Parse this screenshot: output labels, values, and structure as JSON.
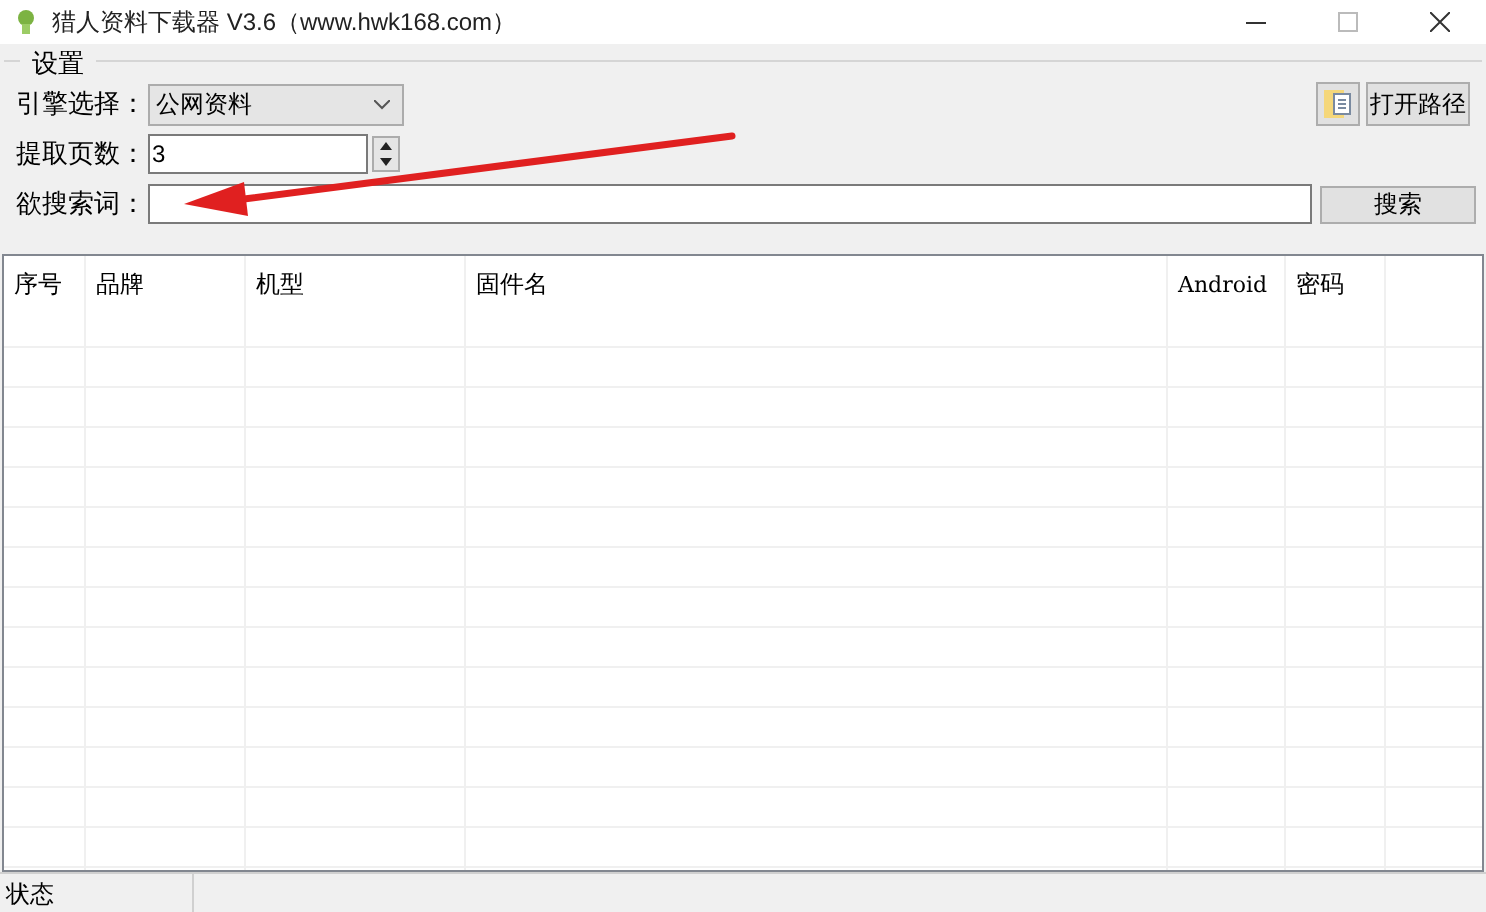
{
  "window": {
    "title": "猎人资料下载器 V3.6（www.hwk168.com）"
  },
  "settings": {
    "title": "设置",
    "engine": {
      "label": "引擎选择：",
      "value": "公网资料"
    },
    "pages": {
      "label": "提取页数：",
      "value": "3"
    },
    "keyword": {
      "label": "欲搜索词："
    },
    "open_path_button": "打开路径",
    "search_button": "搜索"
  },
  "table": {
    "columns": [
      "序号",
      "品牌",
      "机型",
      "固件名",
      "Android",
      "密码"
    ]
  },
  "status_bar": {
    "text": "状态"
  }
}
